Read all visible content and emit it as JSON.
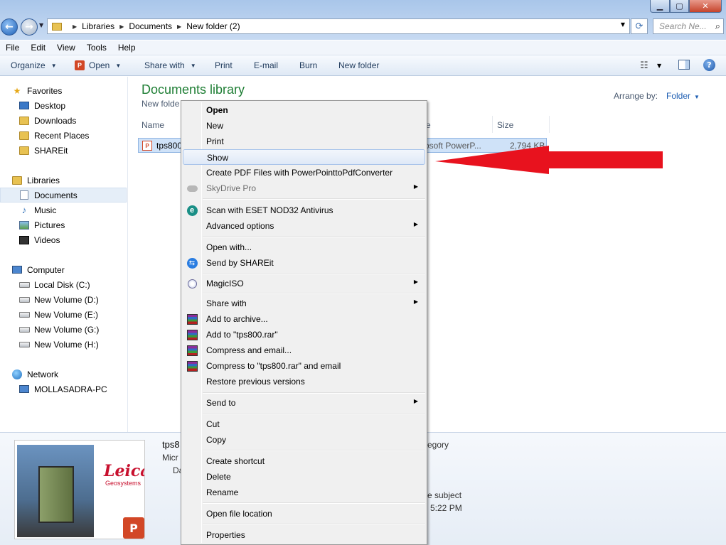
{
  "window": {
    "caption_minimize": "▁",
    "caption_maximize": "▢",
    "caption_close": "✕"
  },
  "address": {
    "crumbs": [
      "Libraries",
      "Documents",
      "New folder (2)"
    ],
    "search_placeholder": "Search Ne..."
  },
  "menubar": [
    "File",
    "Edit",
    "View",
    "Tools",
    "Help"
  ],
  "toolbar": {
    "organize": "Organize",
    "open": "Open",
    "share_with": "Share with",
    "print": "Print",
    "email": "E-mail",
    "burn": "Burn",
    "new_folder": "New folder"
  },
  "nav": {
    "favorites": "Favorites",
    "desktop": "Desktop",
    "downloads": "Downloads",
    "recent_places": "Recent Places",
    "shareit": "SHAREit",
    "libraries": "Libraries",
    "documents": "Documents",
    "music": "Music",
    "pictures": "Pictures",
    "videos": "Videos",
    "computer": "Computer",
    "local_disk": "Local Disk (C:)",
    "vol_d": "New Volume (D:)",
    "vol_e": "New Volume (E:)",
    "vol_g": "New Volume (G:)",
    "vol_h": "New Volume (H:)",
    "network": "Network",
    "pc": "MOLLASADRA-PC"
  },
  "content": {
    "title": "Documents library",
    "subtitle": "New folde",
    "arrange_label": "Arrange by:",
    "arrange_value": "Folder",
    "col_name": "Name",
    "col_type": "e",
    "col_size": "Size",
    "file_name": "tps800",
    "file_type": "rosoft PowerP...",
    "file_size": "2,794 KB"
  },
  "details": {
    "name": "tps8",
    "type": "Micr",
    "date_label": "Da",
    "category": "egory",
    "subject": "e subject",
    "time": "5:22 PM",
    "thumb_brand": "Leica",
    "thumb_sub": "Geosystems"
  },
  "context_menu": {
    "open": "Open",
    "new": "New",
    "print": "Print",
    "show": "Show",
    "create_pdf": "Create PDF Files with PowerPointtoPdfConverter",
    "skydrive": "SkyDrive Pro",
    "eset": "Scan with ESET NOD32 Antivirus",
    "advanced": "Advanced options",
    "open_with": "Open with...",
    "send_shareit": "Send by SHAREit",
    "magiciso": "MagicISO",
    "share_with": "Share with",
    "add_archive": "Add to archive...",
    "add_rar": "Add to \"tps800.rar\"",
    "compress_email": "Compress and email...",
    "compress_rar_email": "Compress to \"tps800.rar\" and email",
    "restore": "Restore previous versions",
    "send_to": "Send to",
    "cut": "Cut",
    "copy": "Copy",
    "create_shortcut": "Create shortcut",
    "delete": "Delete",
    "rename": "Rename",
    "open_location": "Open file location",
    "properties": "Properties"
  },
  "colors": {
    "arrow": "#e8121e",
    "title_green": "#1e7e34",
    "link_blue": "#1f5fb3"
  }
}
